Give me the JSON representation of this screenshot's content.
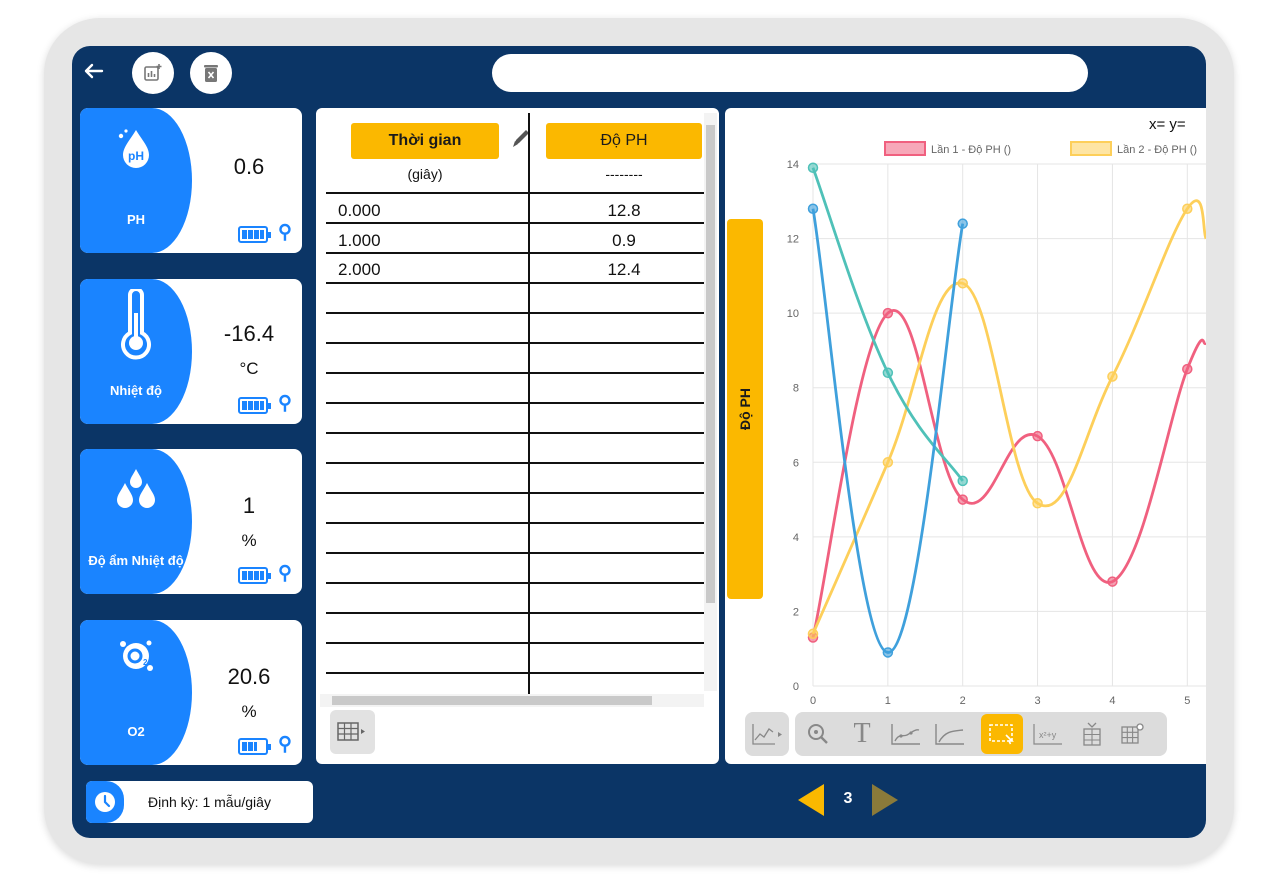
{
  "sensors": [
    {
      "name": "PH",
      "value": "0.6",
      "unit": "",
      "icon": "ph-drop-icon",
      "battery": 1.0
    },
    {
      "name": "Nhiệt độ",
      "value": "-16.4",
      "unit": "°C",
      "icon": "thermometer-icon",
      "battery": 1.0
    },
    {
      "name": "Độ ẩm Nhiệt độ",
      "value": "1",
      "unit": "%",
      "icon": "humidity-drops-icon",
      "battery": 1.0
    },
    {
      "name": "O2",
      "value": "20.6",
      "unit": "%",
      "icon": "o2-icon",
      "battery": 0.7
    }
  ],
  "period": {
    "label": "Định kỳ: 1 mẫu/giây"
  },
  "table": {
    "col1_header": "Thời gian",
    "col1_unit": "(giây)",
    "col2_header": "Độ PH",
    "col2_unit": "--------",
    "rows": [
      [
        "0.000",
        "12.8"
      ],
      [
        "1.000",
        "0.9"
      ],
      [
        "2.000",
        "12.4"
      ]
    ]
  },
  "chart": {
    "yaxis_button": "Độ PH",
    "readout": "x= y=",
    "active_tool": "select-region"
  },
  "pagination": {
    "page": "3"
  },
  "colors": {
    "navy": "#0b3566",
    "blue": "#1a84ff",
    "amber": "#fbb800",
    "series1": "#f0607f",
    "series2": "#fdcf5a",
    "series3": "#4fc1b8",
    "series4": "#3fa0dc"
  },
  "chart_data": {
    "type": "line",
    "title": "",
    "xlabel": "",
    "ylabel": "Độ PH",
    "xlim": [
      0,
      5.25
    ],
    "ylim": [
      0,
      14
    ],
    "x_ticks": [
      0,
      1,
      2,
      3,
      4,
      5
    ],
    "y_ticks": [
      0,
      2,
      4,
      6,
      8,
      10,
      12,
      14
    ],
    "grid": true,
    "legend_position": "top",
    "series": [
      {
        "name": "Lần 1 - Độ PH ()",
        "color": "#f0607f",
        "x": [
          0,
          1,
          2,
          3,
          4,
          5,
          5.25
        ],
        "values": [
          1.3,
          10.0,
          5.0,
          6.7,
          2.8,
          8.5,
          9.2
        ]
      },
      {
        "name": "Lần 2 - Độ PH ()",
        "color": "#fdcf5a",
        "x": [
          0,
          1,
          2,
          3,
          4,
          5,
          5.25
        ],
        "values": [
          1.4,
          6.0,
          10.8,
          4.9,
          8.3,
          12.8,
          12.0
        ]
      },
      {
        "name": "",
        "color": "#4fc1b8",
        "x": [
          0,
          1,
          2
        ],
        "values": [
          13.9,
          8.4,
          5.5
        ]
      },
      {
        "name": "",
        "color": "#3fa0dc",
        "x": [
          0,
          1,
          2
        ],
        "values": [
          12.8,
          0.9,
          12.4
        ]
      }
    ]
  }
}
